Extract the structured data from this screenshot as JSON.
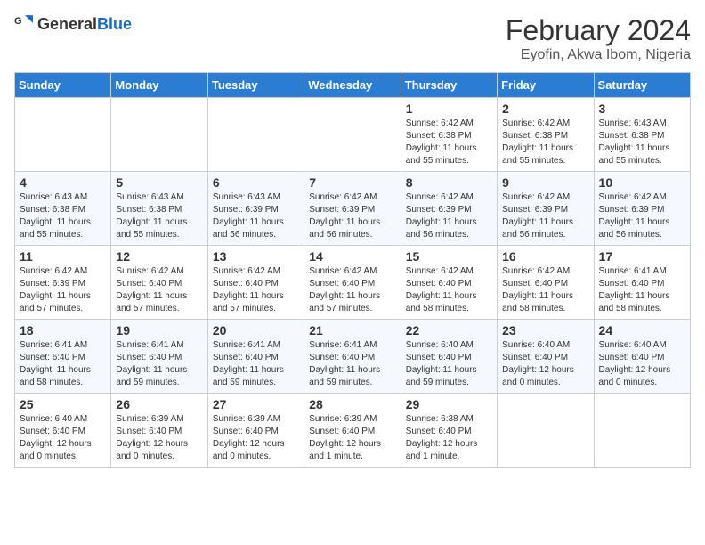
{
  "header": {
    "logo_general": "General",
    "logo_blue": "Blue",
    "month_title": "February 2024",
    "location": "Eyofin, Akwa Ibom, Nigeria"
  },
  "days_of_week": [
    "Sunday",
    "Monday",
    "Tuesday",
    "Wednesday",
    "Thursday",
    "Friday",
    "Saturday"
  ],
  "weeks": [
    [
      {
        "day": "",
        "info": ""
      },
      {
        "day": "",
        "info": ""
      },
      {
        "day": "",
        "info": ""
      },
      {
        "day": "",
        "info": ""
      },
      {
        "day": "1",
        "info": "Sunrise: 6:42 AM\nSunset: 6:38 PM\nDaylight: 11 hours and 55 minutes."
      },
      {
        "day": "2",
        "info": "Sunrise: 6:42 AM\nSunset: 6:38 PM\nDaylight: 11 hours and 55 minutes."
      },
      {
        "day": "3",
        "info": "Sunrise: 6:43 AM\nSunset: 6:38 PM\nDaylight: 11 hours and 55 minutes."
      }
    ],
    [
      {
        "day": "4",
        "info": "Sunrise: 6:43 AM\nSunset: 6:38 PM\nDaylight: 11 hours and 55 minutes."
      },
      {
        "day": "5",
        "info": "Sunrise: 6:43 AM\nSunset: 6:38 PM\nDaylight: 11 hours and 55 minutes."
      },
      {
        "day": "6",
        "info": "Sunrise: 6:43 AM\nSunset: 6:39 PM\nDaylight: 11 hours and 56 minutes."
      },
      {
        "day": "7",
        "info": "Sunrise: 6:42 AM\nSunset: 6:39 PM\nDaylight: 11 hours and 56 minutes."
      },
      {
        "day": "8",
        "info": "Sunrise: 6:42 AM\nSunset: 6:39 PM\nDaylight: 11 hours and 56 minutes."
      },
      {
        "day": "9",
        "info": "Sunrise: 6:42 AM\nSunset: 6:39 PM\nDaylight: 11 hours and 56 minutes."
      },
      {
        "day": "10",
        "info": "Sunrise: 6:42 AM\nSunset: 6:39 PM\nDaylight: 11 hours and 56 minutes."
      }
    ],
    [
      {
        "day": "11",
        "info": "Sunrise: 6:42 AM\nSunset: 6:39 PM\nDaylight: 11 hours and 57 minutes."
      },
      {
        "day": "12",
        "info": "Sunrise: 6:42 AM\nSunset: 6:40 PM\nDaylight: 11 hours and 57 minutes."
      },
      {
        "day": "13",
        "info": "Sunrise: 6:42 AM\nSunset: 6:40 PM\nDaylight: 11 hours and 57 minutes."
      },
      {
        "day": "14",
        "info": "Sunrise: 6:42 AM\nSunset: 6:40 PM\nDaylight: 11 hours and 57 minutes."
      },
      {
        "day": "15",
        "info": "Sunrise: 6:42 AM\nSunset: 6:40 PM\nDaylight: 11 hours and 58 minutes."
      },
      {
        "day": "16",
        "info": "Sunrise: 6:42 AM\nSunset: 6:40 PM\nDaylight: 11 hours and 58 minutes."
      },
      {
        "day": "17",
        "info": "Sunrise: 6:41 AM\nSunset: 6:40 PM\nDaylight: 11 hours and 58 minutes."
      }
    ],
    [
      {
        "day": "18",
        "info": "Sunrise: 6:41 AM\nSunset: 6:40 PM\nDaylight: 11 hours and 58 minutes."
      },
      {
        "day": "19",
        "info": "Sunrise: 6:41 AM\nSunset: 6:40 PM\nDaylight: 11 hours and 59 minutes."
      },
      {
        "day": "20",
        "info": "Sunrise: 6:41 AM\nSunset: 6:40 PM\nDaylight: 11 hours and 59 minutes."
      },
      {
        "day": "21",
        "info": "Sunrise: 6:41 AM\nSunset: 6:40 PM\nDaylight: 11 hours and 59 minutes."
      },
      {
        "day": "22",
        "info": "Sunrise: 6:40 AM\nSunset: 6:40 PM\nDaylight: 11 hours and 59 minutes."
      },
      {
        "day": "23",
        "info": "Sunrise: 6:40 AM\nSunset: 6:40 PM\nDaylight: 12 hours and 0 minutes."
      },
      {
        "day": "24",
        "info": "Sunrise: 6:40 AM\nSunset: 6:40 PM\nDaylight: 12 hours and 0 minutes."
      }
    ],
    [
      {
        "day": "25",
        "info": "Sunrise: 6:40 AM\nSunset: 6:40 PM\nDaylight: 12 hours and 0 minutes."
      },
      {
        "day": "26",
        "info": "Sunrise: 6:39 AM\nSunset: 6:40 PM\nDaylight: 12 hours and 0 minutes."
      },
      {
        "day": "27",
        "info": "Sunrise: 6:39 AM\nSunset: 6:40 PM\nDaylight: 12 hours and 0 minutes."
      },
      {
        "day": "28",
        "info": "Sunrise: 6:39 AM\nSunset: 6:40 PM\nDaylight: 12 hours and 1 minute."
      },
      {
        "day": "29",
        "info": "Sunrise: 6:38 AM\nSunset: 6:40 PM\nDaylight: 12 hours and 1 minute."
      },
      {
        "day": "",
        "info": ""
      },
      {
        "day": "",
        "info": ""
      }
    ]
  ]
}
